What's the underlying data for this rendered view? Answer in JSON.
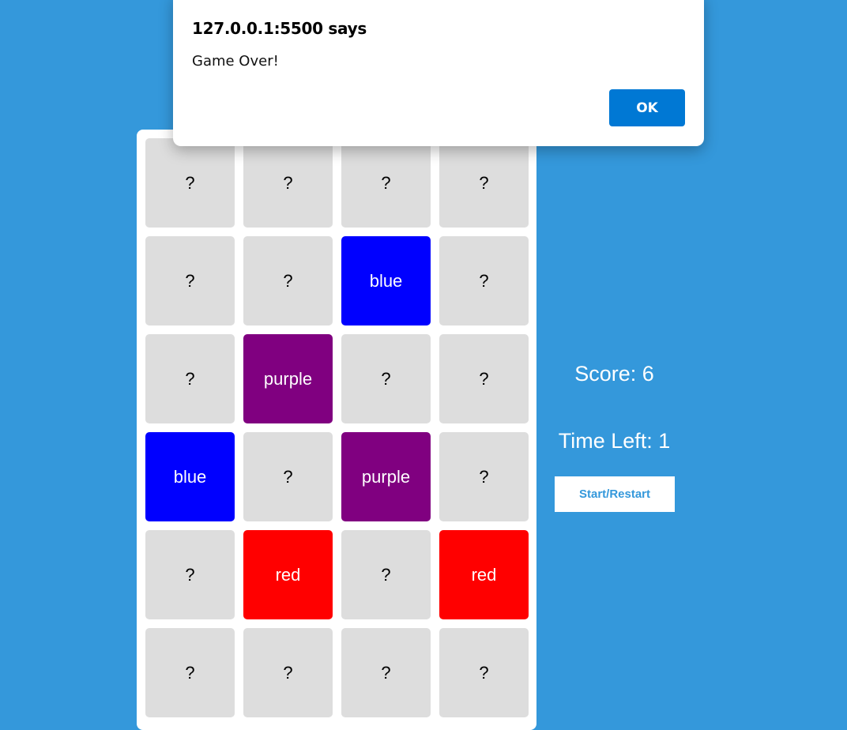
{
  "game": {
    "score_text": "Score: 6",
    "time_text": "Time Left: 1",
    "start_button_label": "Start/Restart",
    "cards": [
      {
        "label": "?",
        "revealed": false,
        "color": "#dddddd"
      },
      {
        "label": "?",
        "revealed": false,
        "color": "#dddddd"
      },
      {
        "label": "?",
        "revealed": false,
        "color": "#dddddd"
      },
      {
        "label": "?",
        "revealed": false,
        "color": "#dddddd"
      },
      {
        "label": "?",
        "revealed": false,
        "color": "#dddddd"
      },
      {
        "label": "?",
        "revealed": false,
        "color": "#dddddd"
      },
      {
        "label": "blue",
        "revealed": true,
        "color": "#0000ff"
      },
      {
        "label": "?",
        "revealed": false,
        "color": "#dddddd"
      },
      {
        "label": "?",
        "revealed": false,
        "color": "#dddddd"
      },
      {
        "label": "purple",
        "revealed": true,
        "color": "#800080"
      },
      {
        "label": "?",
        "revealed": false,
        "color": "#dddddd"
      },
      {
        "label": "?",
        "revealed": false,
        "color": "#dddddd"
      },
      {
        "label": "blue",
        "revealed": true,
        "color": "#0000ff"
      },
      {
        "label": "?",
        "revealed": false,
        "color": "#dddddd"
      },
      {
        "label": "purple",
        "revealed": true,
        "color": "#800080"
      },
      {
        "label": "?",
        "revealed": false,
        "color": "#dddddd"
      },
      {
        "label": "?",
        "revealed": false,
        "color": "#dddddd"
      },
      {
        "label": "red",
        "revealed": true,
        "color": "#ff0000"
      },
      {
        "label": "?",
        "revealed": false,
        "color": "#dddddd"
      },
      {
        "label": "red",
        "revealed": true,
        "color": "#ff0000"
      },
      {
        "label": "?",
        "revealed": false,
        "color": "#dddddd"
      },
      {
        "label": "?",
        "revealed": false,
        "color": "#dddddd"
      },
      {
        "label": "?",
        "revealed": false,
        "color": "#dddddd"
      },
      {
        "label": "?",
        "revealed": false,
        "color": "#dddddd"
      }
    ]
  },
  "dialog": {
    "title": "127.0.0.1:5500 says",
    "message": "Game Over!",
    "ok_label": "OK"
  },
  "colors": {
    "page_background": "#3498db",
    "card_hidden": "#dddddd",
    "dialog_button": "#0078d4"
  }
}
